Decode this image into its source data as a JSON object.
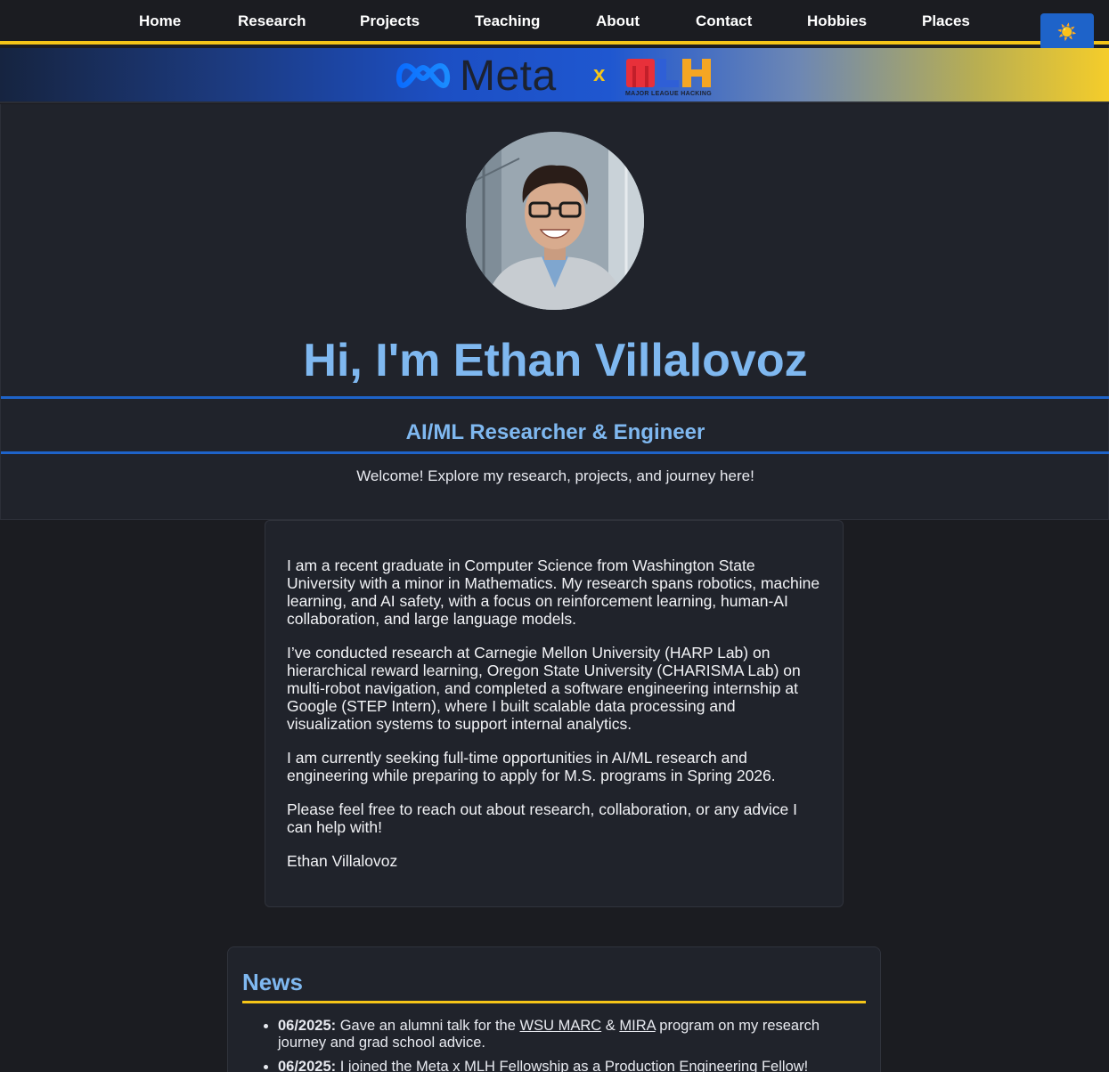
{
  "nav": {
    "items": [
      "Home",
      "Research",
      "Projects",
      "Teaching",
      "About",
      "Contact",
      "Hobbies",
      "Places"
    ],
    "theme_toggle": "☀️"
  },
  "banner": {
    "meta": "Meta",
    "x": "x",
    "mlh": "MLH",
    "mlh_sub": "MAJOR LEAGUE HACKING"
  },
  "hero": {
    "title": "Hi, I'm Ethan Villalovoz",
    "subtitle": "AI/ML Researcher & Engineer",
    "welcome": "Welcome! Explore my research, projects, and journey here!"
  },
  "about": {
    "paragraphs": [
      "I am a recent graduate in Computer Science from Washington State University with a minor in Mathematics. My research spans robotics, machine learning, and AI safety, with a focus on reinforcement learning, human-AI collaboration, and large language models.",
      "I’ve conducted research at Carnegie Mellon University (HARP Lab) on hierarchical reward learning, Oregon State University (CHARISMA Lab) on multi-robot navigation, and completed a software engineering internship at Google (STEP Intern), where I built scalable data processing and visualization systems to support internal analytics.",
      "I am currently seeking full-time opportunities in AI/ML research and engineering while preparing to apply for M.S. programs in Spring 2026.",
      "Please feel free to reach out about research, collaboration, or any advice I can help with!",
      "Ethan Villalovoz"
    ]
  },
  "news": {
    "title": "News",
    "items": [
      {
        "date": "06/2025:",
        "text_before": " Gave an alumni talk for the ",
        "link1": "WSU MARC",
        "text_mid": " & ",
        "link2": "MIRA",
        "text_after": " program on my research journey and grad school advice."
      },
      {
        "date": "06/2025:",
        "text": " I joined the Meta x MLH Fellowship as a Production Engineering Fellow!"
      }
    ]
  },
  "colors": {
    "accent_blue": "#7fb8f0",
    "rule_blue": "#1e63c9",
    "accent_yellow": "#f5c518",
    "background": "#1b1c21",
    "card": "#20232b"
  }
}
